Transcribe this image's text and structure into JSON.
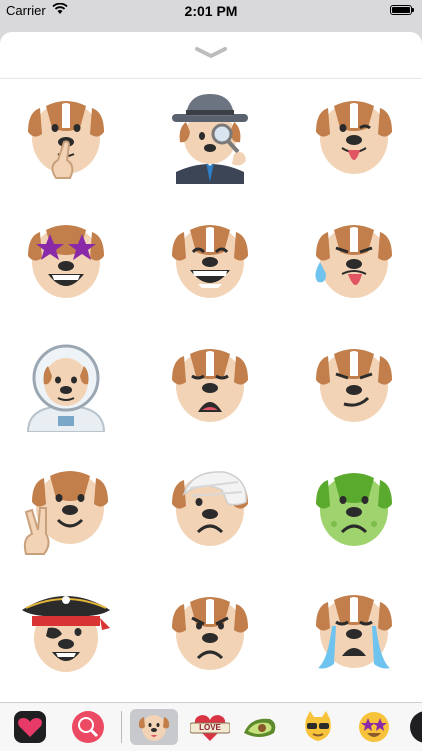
{
  "status_bar": {
    "carrier": "Carrier",
    "time": "2:01 PM",
    "battery_level": 1.0
  },
  "sheet": {
    "grabber_icon": "chevron-down-icon"
  },
  "stickers": [
    {
      "name": "shush-dog"
    },
    {
      "name": "detective-dog"
    },
    {
      "name": "wink-tongue-dog"
    },
    {
      "name": "star-eyes-dog"
    },
    {
      "name": "grin-dog"
    },
    {
      "name": "sweat-tongue-dog"
    },
    {
      "name": "astronaut-dog"
    },
    {
      "name": "weary-dog"
    },
    {
      "name": "smirk-dog"
    },
    {
      "name": "peace-dog"
    },
    {
      "name": "bandage-dog"
    },
    {
      "name": "sick-dog"
    },
    {
      "name": "pirate-dog"
    },
    {
      "name": "angry-dog"
    },
    {
      "name": "crying-dog"
    }
  ],
  "app_tray": {
    "apps": [
      "heart-message-app",
      "world-search-app",
      "dog-stickers-app",
      "love-banner-app",
      "avocado-app",
      "cool-cat-app",
      "star-eyes-app",
      "more-app"
    ],
    "love_text": "LOVE"
  }
}
